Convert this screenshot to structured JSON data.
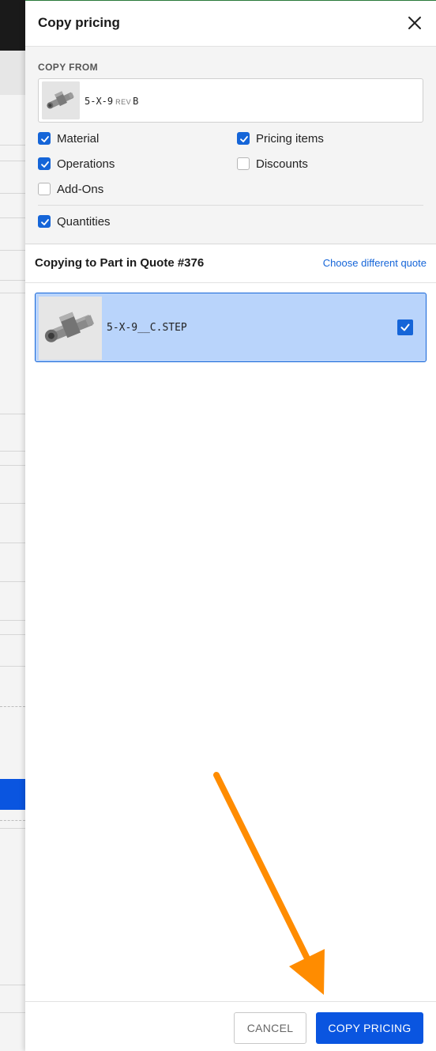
{
  "drawer": {
    "title": "Copy pricing",
    "close_icon": "close-icon"
  },
  "copy_from": {
    "label": "COPY FROM",
    "part_name": "5-X-9",
    "rev_label": "REV",
    "rev_value": "B",
    "options": [
      {
        "label": "Material",
        "checked": true
      },
      {
        "label": "Pricing items",
        "checked": true
      },
      {
        "label": "Operations",
        "checked": true
      },
      {
        "label": "Discounts",
        "checked": false
      },
      {
        "label": "Add-Ons",
        "checked": false
      },
      {
        "label": "Quantities",
        "checked": true
      }
    ]
  },
  "copy_to": {
    "title": "Copying to Part in Quote #376",
    "change_link": "Choose different quote",
    "target": {
      "name": "5-X-9__C.STEP",
      "selected": true
    }
  },
  "footer": {
    "cancel_label": "CANCEL",
    "copy_label": "COPY PRICING"
  },
  "colors": {
    "accent": "#0a55e0",
    "selected_bg": "#b9d4fb",
    "annotation_arrow": "#ff8c00"
  }
}
